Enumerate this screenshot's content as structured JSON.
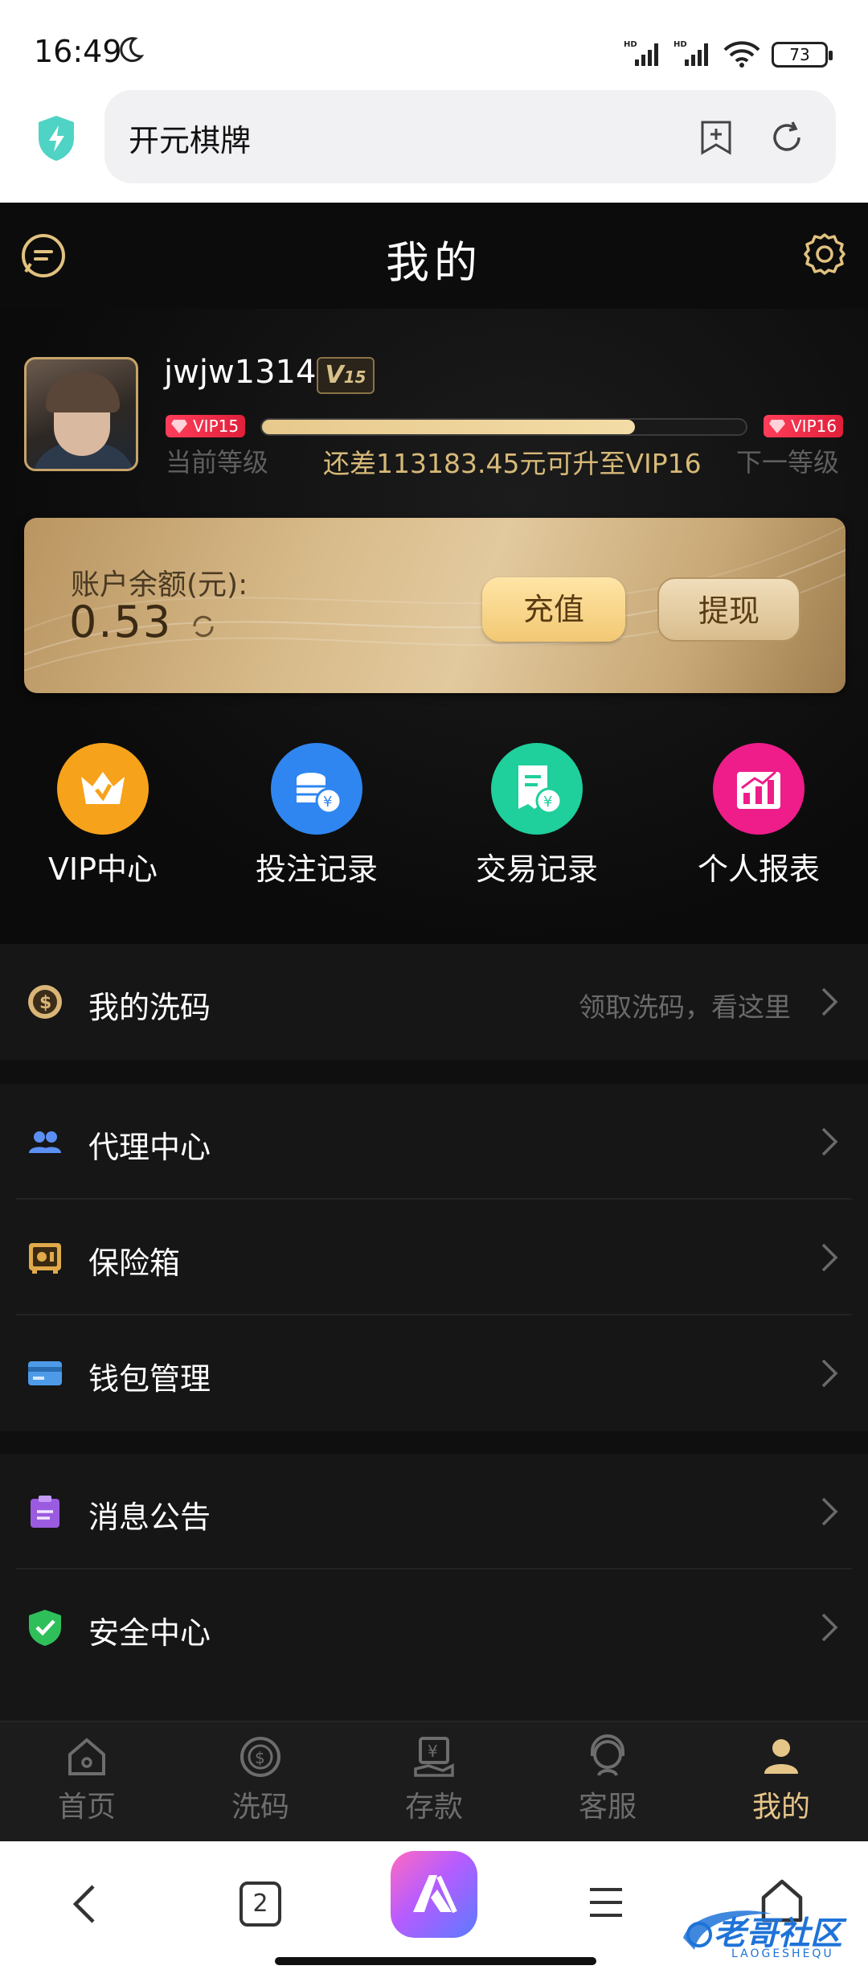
{
  "status_bar": {
    "time": "16:49",
    "battery": "73"
  },
  "browser": {
    "url_title": "开元棋牌"
  },
  "header": {
    "title": "我的"
  },
  "profile": {
    "username": "jwjw1314",
    "vip_badge": "V",
    "vip_badge_num": "15",
    "current_vip": "VIP15",
    "next_vip": "VIP16",
    "progress_fraction": 0.77,
    "current_level_label": "当前等级",
    "next_level_label": "下一等级",
    "upgrade_hint": "还差113183.45元可升至VIP16"
  },
  "balance": {
    "label": "账户余额(元):",
    "amount": "0.53",
    "recharge_label": "充值",
    "withdraw_label": "提现"
  },
  "quick_actions": [
    {
      "label": "VIP中心",
      "icon": "crown-icon",
      "color": "#f7a21b"
    },
    {
      "label": "投注记录",
      "icon": "coins-icon",
      "color": "#2f86f0"
    },
    {
      "label": "交易记录",
      "icon": "receipt-icon",
      "color": "#1fcf9c"
    },
    {
      "label": "个人报表",
      "icon": "chart-icon",
      "color": "#ee1d8a"
    }
  ],
  "menu": {
    "wash": {
      "label": "我的洗码",
      "hint": "领取洗码，看这里"
    },
    "agent": {
      "label": "代理中心"
    },
    "safe": {
      "label": "保险箱"
    },
    "wallet": {
      "label": "钱包管理"
    },
    "notice": {
      "label": "消息公告"
    },
    "security": {
      "label": "安全中心"
    }
  },
  "tabbar": [
    {
      "label": "首页",
      "icon": "home-icon"
    },
    {
      "label": "洗码",
      "icon": "wash-icon"
    },
    {
      "label": "存款",
      "icon": "deposit-icon"
    },
    {
      "label": "客服",
      "icon": "support-icon"
    },
    {
      "label": "我的",
      "icon": "user-icon",
      "active": true
    }
  ],
  "system_nav": {
    "tab_count": "2"
  },
  "watermark": {
    "text": "老哥社区",
    "sub": "LAOGESHEQU"
  },
  "colors": {
    "gold": "#e6c588",
    "background": "#0f0f0f",
    "vip_red": "#e0203a"
  }
}
